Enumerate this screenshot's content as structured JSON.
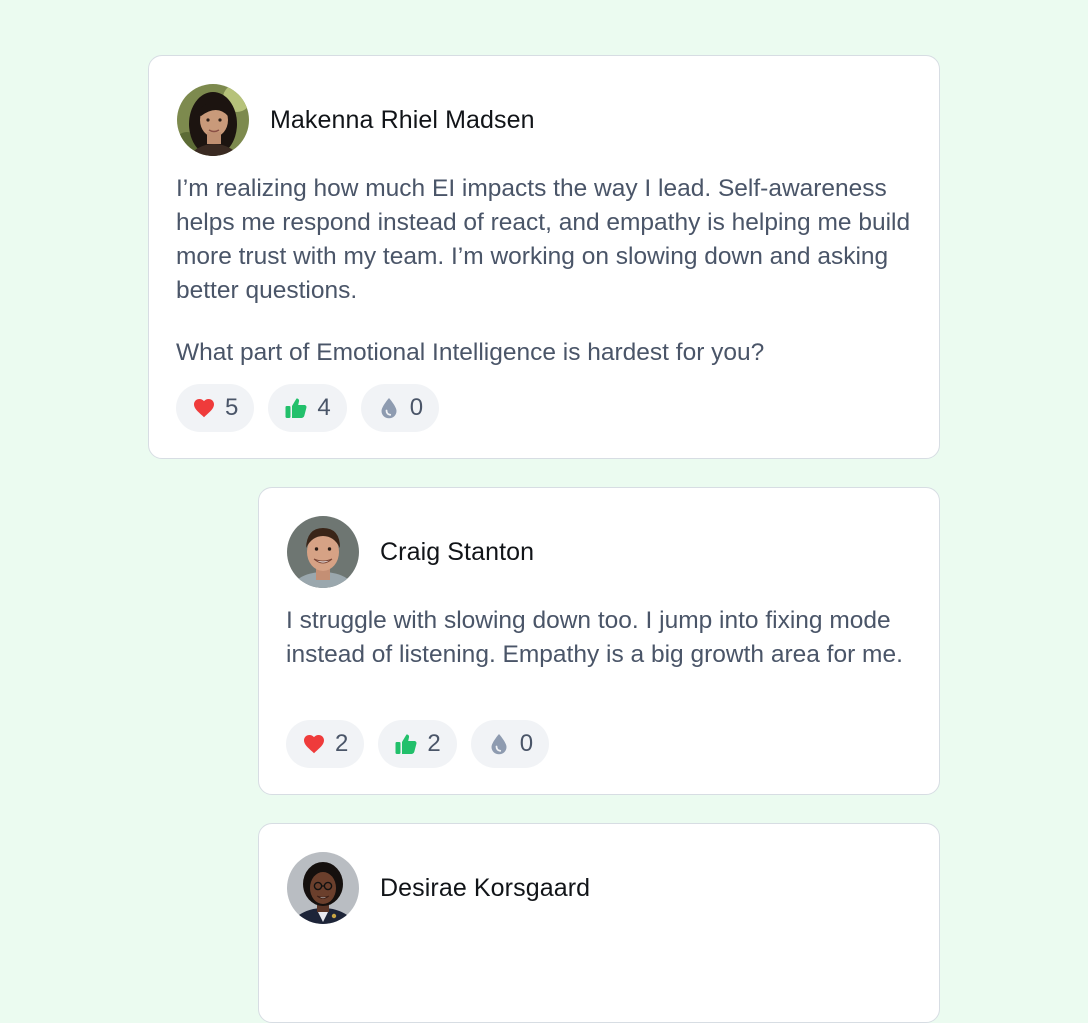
{
  "thread": [
    {
      "id": "post",
      "author": "Makenna Rhiel Madsen",
      "paragraphs": [
        "I’m realizing how much EI impacts the way I lead. Self-awareness helps me respond instead of react, and empathy is helping me build more trust with my team. I’m working on slowing down and asking better questions.",
        "What part of Emotional Intelligence is hardest for you?"
      ],
      "reactions": {
        "heart": "5",
        "thumbs_up": "4",
        "drop": "0"
      }
    },
    {
      "id": "reply1",
      "author": "Craig Stanton",
      "paragraphs": [
        "I struggle with slowing down too. I jump into fixing mode instead of listening. Empathy is a big growth area for me."
      ],
      "reactions": {
        "heart": "2",
        "thumbs_up": "2",
        "drop": "0"
      }
    },
    {
      "id": "reply2",
      "author": "Desirae Korsgaard"
    }
  ],
  "icons": {
    "heart": "heart-icon",
    "thumbs_up": "thumbs-up-icon",
    "drop": "drop-icon"
  },
  "colors": {
    "page_background": "#ebfbf0",
    "heart": "#ef3b3b",
    "thumbs_up": "#22c06b",
    "drop": "#8e9bb0",
    "body_text": "#4a5568",
    "name_text": "#111418"
  }
}
